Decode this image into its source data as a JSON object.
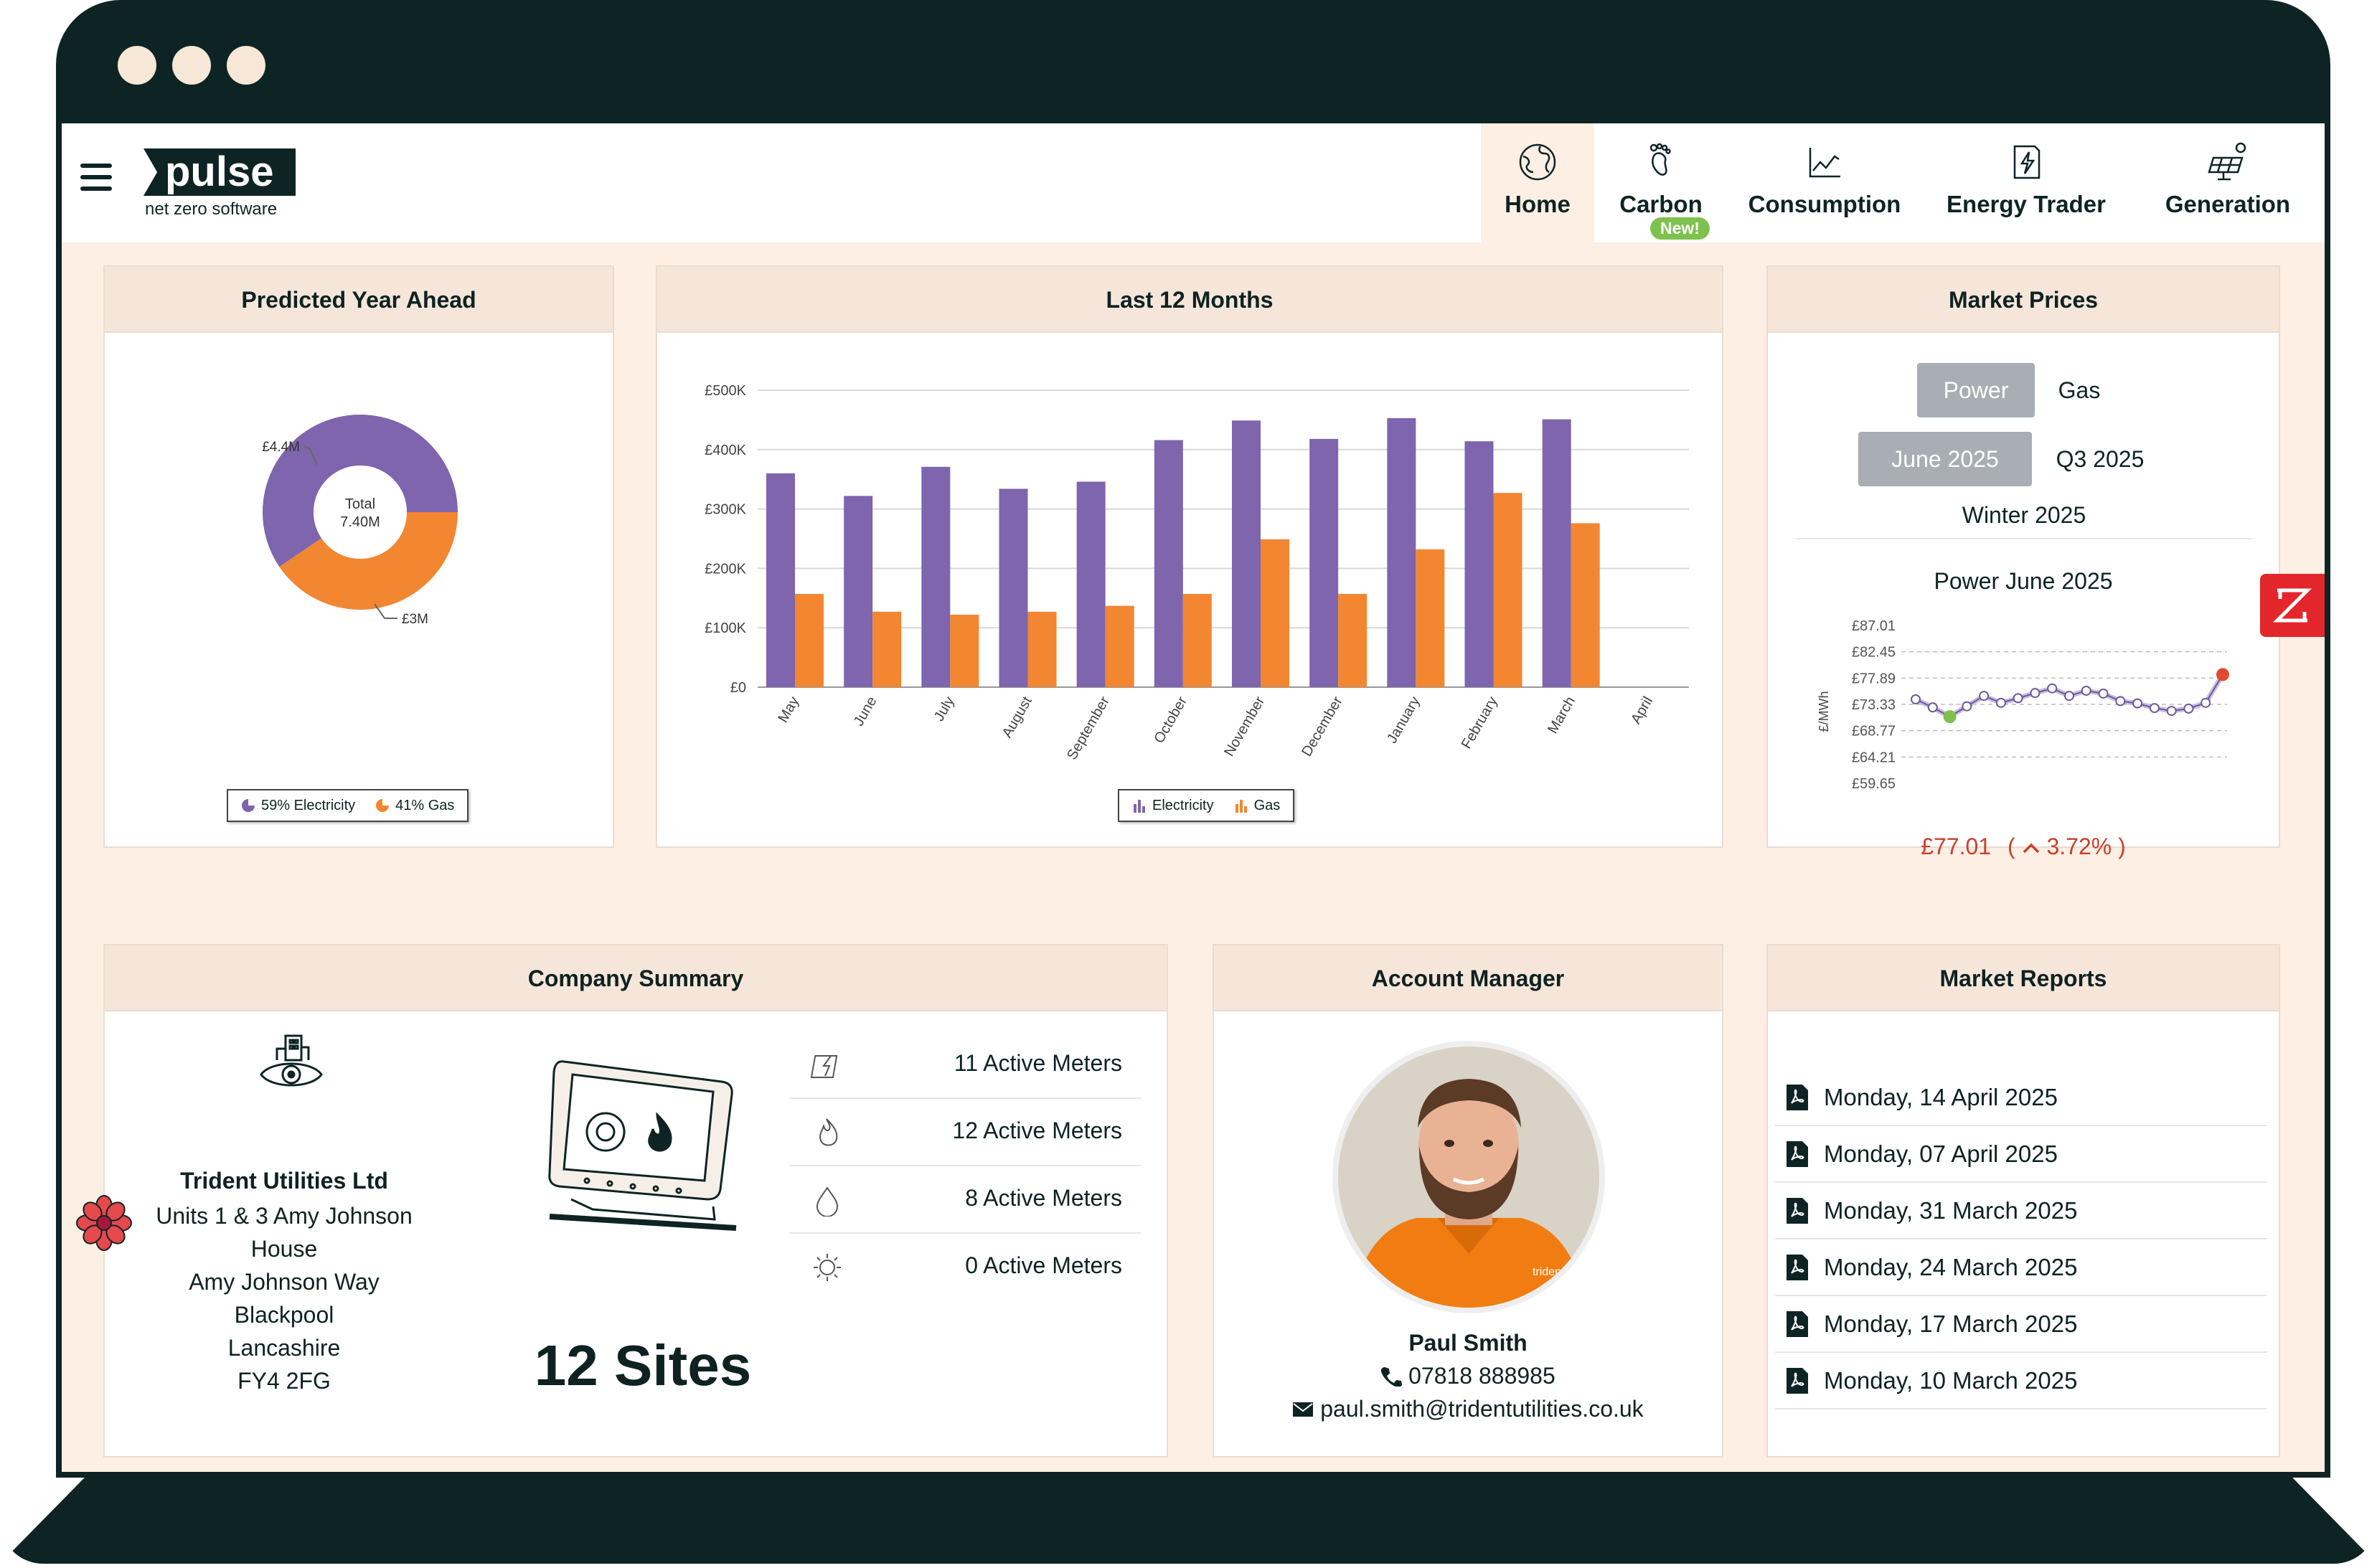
{
  "brand": {
    "name": "pulse",
    "tagline": "net zero software"
  },
  "nav": [
    {
      "label": "Home",
      "icon": "globe-icon",
      "active": true
    },
    {
      "label": "Carbon",
      "icon": "footprint-icon",
      "badge": "New!"
    },
    {
      "label": "Consumption",
      "icon": "line-chart-icon"
    },
    {
      "label": "Energy Trader",
      "icon": "lightning-doc-icon"
    },
    {
      "label": "Generation",
      "icon": "solar-panel-icon"
    }
  ],
  "predicted": {
    "title": "Predicted Year Ahead",
    "center_label": "Total",
    "center_value": "7.40M",
    "callout_electricity": "£4.4M",
    "callout_gas": "£3M",
    "legend_electricity": "59% Electricity",
    "legend_gas": "41% Gas"
  },
  "last12": {
    "title": "Last 12 Months",
    "legend_electricity": "Electricity",
    "legend_gas": "Gas"
  },
  "market": {
    "title": "Market Prices",
    "commodity_on": "Power",
    "commodity_off": "Gas",
    "period_on": "June 2025",
    "period_alt": "Q3 2025",
    "period_alt2": "Winter 2025",
    "chart_title": "Power June 2025",
    "ylabel": "£/MWh",
    "price": "£77.01",
    "change": "3.72%",
    "price_color": "#c9402a"
  },
  "company": {
    "title": "Company Summary",
    "name": "Trident Utilities Ltd",
    "address": [
      "Units 1 & 3 Amy Johnson",
      "House",
      "Amy Johnson Way",
      "Blackpool",
      "Lancashire",
      "FY4 2FG"
    ],
    "sites": "12 Sites",
    "meters": [
      {
        "icon": "electricity-icon",
        "text": "11 Active Meters"
      },
      {
        "icon": "flame-icon",
        "text": "12 Active Meters"
      },
      {
        "icon": "water-drop-icon",
        "text": "8 Active Meters"
      },
      {
        "icon": "sun-icon",
        "text": "0 Active Meters"
      }
    ]
  },
  "manager": {
    "title": "Account Manager",
    "name": "Paul Smith",
    "phone": "07818 888985",
    "email": "paul.smith@tridentutilities.co.uk",
    "shirt_text": "trident"
  },
  "reports": {
    "title": "Market Reports",
    "items": [
      "Monday, 14 April 2025",
      "Monday, 07 April 2025",
      "Monday, 31 March 2025",
      "Monday, 24 March 2025",
      "Monday, 17 March 2025",
      "Monday, 10 March 2025"
    ]
  },
  "colors": {
    "electricity": "#7e65ad",
    "gas": "#f38630",
    "frame": "#0e2424",
    "page": "#fdefe4"
  },
  "chart_data": [
    {
      "type": "pie",
      "categories": [
        "Electricity",
        "Gas"
      ],
      "values": [
        4.4,
        3.0
      ],
      "labels": [
        "£4.4M",
        "£3M"
      ],
      "title": "Predicted Year Ahead"
    },
    {
      "type": "bar",
      "title": "Last 12 Months",
      "categories": [
        "May",
        "June",
        "July",
        "August",
        "September",
        "October",
        "November",
        "December",
        "January",
        "February",
        "March",
        "April"
      ],
      "series": [
        {
          "name": "Electricity",
          "values": [
            360000,
            322000,
            371000,
            334000,
            346000,
            416000,
            449000,
            418000,
            453000,
            414000,
            451000,
            0
          ]
        },
        {
          "name": "Gas",
          "values": [
            157000,
            127000,
            122000,
            127000,
            137000,
            157000,
            249000,
            157000,
            232000,
            327000,
            276000,
            0
          ]
        }
      ],
      "yticks": [
        "£0",
        "£100K",
        "£200K",
        "£300K",
        "£400K",
        "£500K"
      ],
      "ylim": [
        0,
        500000
      ],
      "legend": "bottom"
    },
    {
      "type": "line",
      "title": "Power June 2025",
      "ylabel": "£/MWh",
      "yticks": [
        "£59.65",
        "£64.21",
        "£68.77",
        "£73.33",
        "£77.89",
        "£82.45",
        "£87.01"
      ],
      "ylim": [
        59.65,
        87.01
      ],
      "values": [
        74.2,
        72.8,
        71.2,
        73.0,
        74.8,
        73.6,
        74.4,
        75.3,
        76.1,
        74.8,
        75.7,
        75.2,
        73.9,
        73.5,
        72.7,
        72.2,
        72.6,
        73.6,
        78.5
      ]
    }
  ]
}
